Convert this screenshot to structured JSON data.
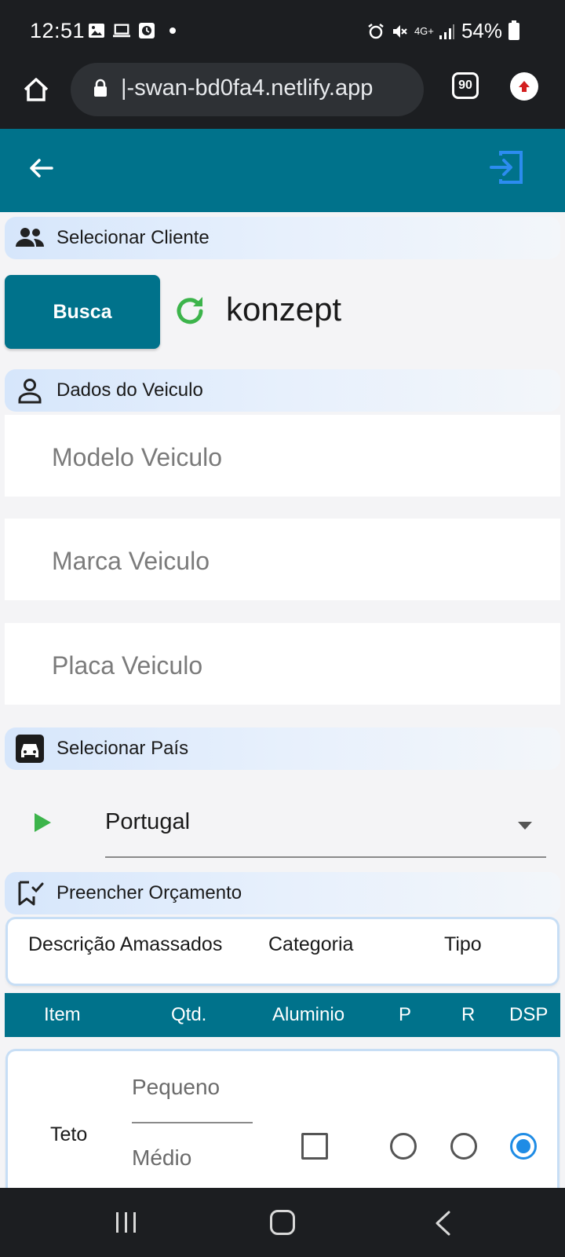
{
  "status_bar": {
    "time": "12:51",
    "network": "4G+",
    "battery": "54%"
  },
  "browser": {
    "url": "|-swan-bd0fa4.netlify.app",
    "tab_count": "90"
  },
  "sections": {
    "cliente": "Selecionar Cliente",
    "veiculo": "Dados do Veiculo",
    "pais": "Selecionar País",
    "orcamento": "Preencher Orçamento"
  },
  "cliente": {
    "busca_label": "Busca",
    "name": "konzept"
  },
  "veiculo_fields": {
    "modelo_placeholder": "Modelo Veiculo",
    "marca_placeholder": "Marca Veiculo",
    "placa_placeholder": "Placa Veiculo"
  },
  "pais": {
    "selected": "Portugal"
  },
  "orcamento_header": {
    "col1": "Descrição Amassados",
    "col2": "Categoria",
    "col3": "Tipo"
  },
  "table_headers": [
    "Item",
    "Qtd.",
    "Aluminio",
    "P",
    "R",
    "DSP"
  ],
  "rows": [
    {
      "item": "Teto",
      "size_option_1": "Pequeno",
      "size_option_2": "Médio",
      "aluminio_checked": false,
      "selected_type": "DSP"
    }
  ],
  "colors": {
    "primary": "#00728b",
    "accent_green": "#3cb44b",
    "radio_selected": "#1f8ce5",
    "logout_icon": "#2c8cf0"
  },
  "icons": {
    "back": "arrow-left-icon",
    "logout": "exit-to-app-icon",
    "cliente": "people-icon",
    "veiculo": "person-outline-icon",
    "pais": "car-icon",
    "orcamento": "checklist-icon",
    "refresh": "refresh-icon",
    "play": "play-icon"
  }
}
